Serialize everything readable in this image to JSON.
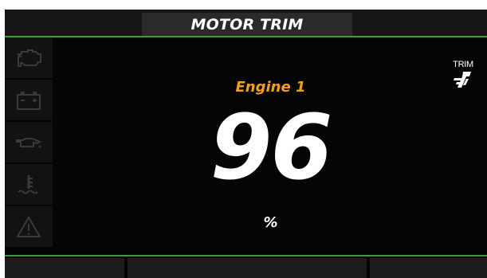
{
  "header": {
    "title": "MOTOR TRIM"
  },
  "sidebar": {
    "icons": [
      "engine-check-icon",
      "battery-icon",
      "oil-pressure-icon",
      "coolant-temperature-icon",
      "warning-triangle-icon"
    ]
  },
  "main": {
    "engine_label": "Engine 1",
    "trim_value": "96",
    "trim_unit": "%",
    "trim_badge_label": "TRIM",
    "trim_badge_icon": "motor-trim-icon"
  },
  "footer": {
    "softkeys": [
      "",
      "",
      "",
      ""
    ]
  },
  "colors": {
    "accent_green": "#2fa33a",
    "engine_label": "#f2a01c",
    "background": "#050505",
    "icon_dim": "#3a3a3a"
  }
}
